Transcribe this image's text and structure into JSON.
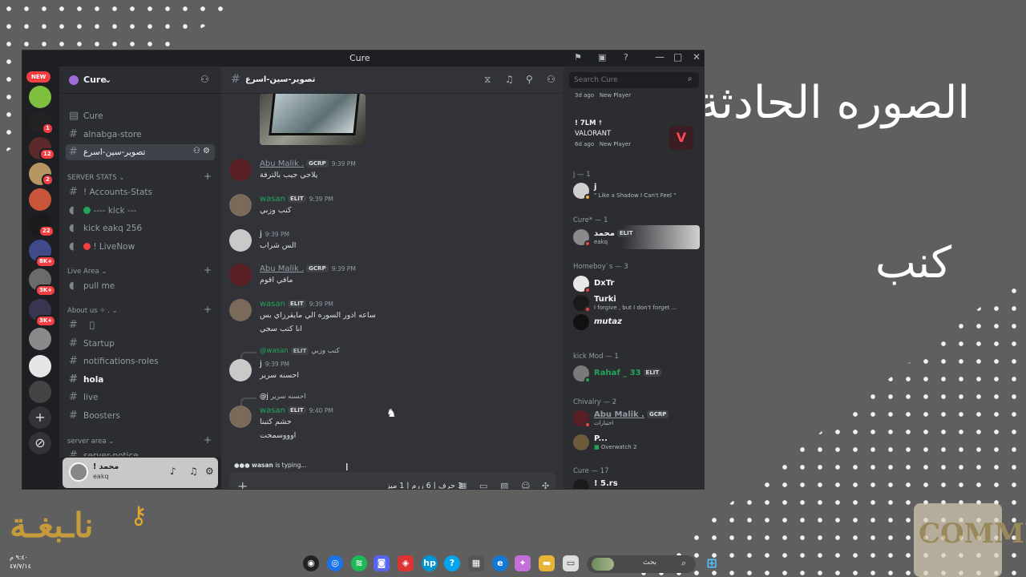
{
  "background": {
    "title_text": "الصوره الحادثة",
    "word_text": "كنب"
  },
  "window": {
    "title": "Cure",
    "controls": [
      "—",
      "□",
      "✕"
    ]
  },
  "rail": {
    "new_label": "NEW",
    "badges": [
      "1",
      "12",
      "2",
      "22",
      "8K+",
      "3K+",
      "3K+"
    ]
  },
  "server": {
    "name": "Cure",
    "channels_top": [
      {
        "name": "Cure",
        "type": "text"
      },
      {
        "name": "alnabga-store",
        "type": "text"
      },
      {
        "name": "تصوير-سين-اسرع",
        "type": "text",
        "active": true
      }
    ],
    "categories": [
      {
        "name": "SERVER STATS",
        "items": [
          {
            "name": "! Accounts-Stats",
            "type": "text"
          },
          {
            "name": "---- kick ---",
            "type": "voice"
          },
          {
            "name": "kick eakq 256",
            "type": "voice"
          },
          {
            "name": "! LiveNow",
            "type": "voice"
          }
        ]
      },
      {
        "name": "Live Area",
        "items": [
          {
            "name": "pull me",
            "type": "voice"
          }
        ]
      },
      {
        "name": "About us ✧ .",
        "items": [
          {
            "name": "⠀⃟",
            "type": "text"
          },
          {
            "name": "Startup",
            "type": "text"
          },
          {
            "name": "notifications-roles",
            "type": "text"
          },
          {
            "name": "hola",
            "type": "text",
            "bold": true
          },
          {
            "name": "live",
            "type": "text"
          },
          {
            "name": "Boosters",
            "type": "text"
          }
        ]
      },
      {
        "name": "server area",
        "items": [
          {
            "name": "server-notice",
            "type": "text"
          }
        ]
      }
    ]
  },
  "user": {
    "name": "! محمد",
    "sub": "eakq"
  },
  "chat": {
    "channel": "تصوير-سين-اسرع",
    "messages": [
      {
        "author": "Abu Malik .",
        "tag": "GCRP",
        "time": "9:39 PM",
        "lines": [
          "يلاحي جيب بالترفة"
        ],
        "color": "#949ba4"
      },
      {
        "author": "wasan",
        "tag": "ELIT",
        "time": "9:39 PM",
        "lines": [
          "كنب وزبي"
        ],
        "color": "#23a559"
      },
      {
        "author": "j",
        "tag": "",
        "time": "9:39 PM",
        "lines": [
          "الس شراب"
        ],
        "color": "#f2f3f5"
      },
      {
        "author": "Abu Malik .",
        "tag": "GCRP",
        "time": "9:39 PM",
        "lines": [
          "مافي اقوم"
        ],
        "color": "#949ba4"
      },
      {
        "author": "wasan",
        "tag": "ELIT",
        "time": "9:39 PM",
        "lines": [
          "ساعه ادور السوره الي مايقرزاي بس",
          "انا كتب سجي"
        ],
        "color": "#23a559"
      },
      {
        "author": "j",
        "tag": "",
        "time": "9:39 PM",
        "lines": [
          "احسنه سرير"
        ],
        "color": "#f2f3f5",
        "reply": {
          "author": "@wasan",
          "tag": "ELIT",
          "text": "كنب وزبي"
        }
      },
      {
        "author": "wasan",
        "tag": "ELIT",
        "time": "9:40 PM",
        "lines": [
          "حشم كتبنا",
          "اوووسمحت"
        ],
        "color": "#23a559",
        "reply": {
          "author": "@j",
          "tag": "",
          "text": "احسنه سرير"
        }
      }
    ],
    "typing_user": "wasan",
    "typing_suffix": " is typing...",
    "composer_value": "3 حرف | 6 زرم | 1 ميز"
  },
  "members": {
    "search_placeholder": "Search Cure",
    "top_entries": [
      {
        "meta": "3d ago",
        "status": "New Player"
      },
      {
        "name": "! 7LM ☨",
        "game": "VALORANT",
        "meta": "6d ago",
        "status": "New Player"
      }
    ],
    "groups": [
      {
        "title": "j — 1",
        "members": [
          {
            "name": "j",
            "sub": "\" Like a Shadow I Can't Feel \""
          }
        ]
      },
      {
        "title": "Cure* — 1",
        "members": [
          {
            "name": "محمد",
            "tag": "ELIT",
            "sub": "eakq"
          }
        ]
      },
      {
        "title": "Homeboy`s — 3",
        "members": [
          {
            "name": "DxTr",
            "sub": ""
          },
          {
            "name": "Turki",
            "sub": "I forgive , but I don't forget ..."
          },
          {
            "name": "mutaz",
            "sub": ""
          }
        ]
      },
      {
        "title": "kick Mod — 1",
        "members": [
          {
            "name": "Rahaf _ 33",
            "tag": "ELIT",
            "sub": ""
          }
        ]
      },
      {
        "title": "Chivalry — 2",
        "members": [
          {
            "name": "Abu Malik .",
            "tag": "GCRP",
            "sub": "اختبارات"
          },
          {
            "name": "P...",
            "sub": "Overwatch 2"
          }
        ]
      },
      {
        "title": "Cure — 17",
        "members": [
          {
            "name": "! 5.rs",
            "sub": ""
          }
        ]
      }
    ]
  },
  "taskbar": {
    "search_text": "بحث",
    "clock_time": "٩:٤٠ م",
    "clock_date": "٤٧/٧/١٤"
  },
  "colors": {
    "accent_green": "#23a559",
    "danger": "#f23f43",
    "valorant": "#ff4655"
  }
}
